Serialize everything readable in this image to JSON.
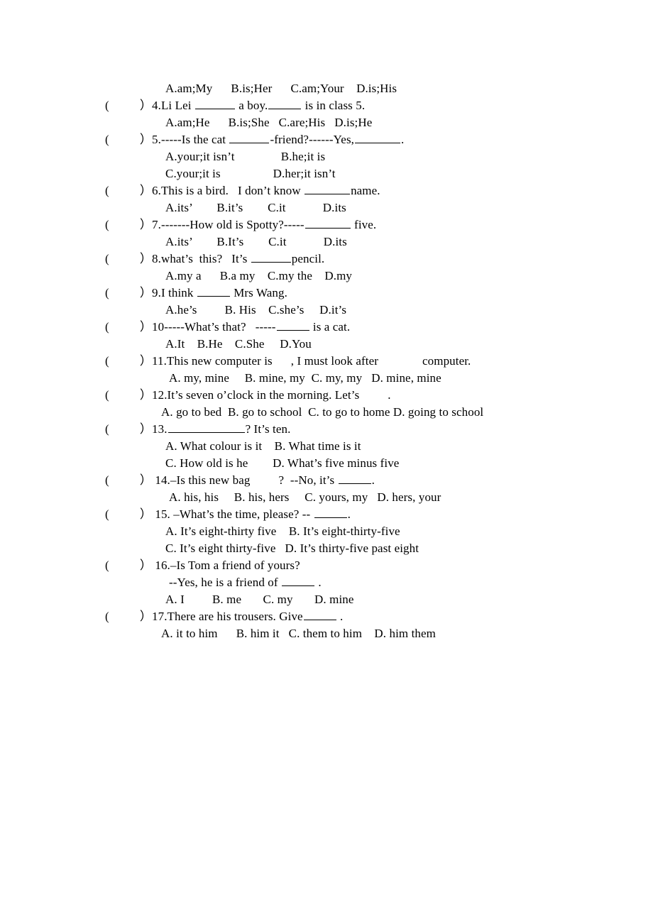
{
  "document": {
    "type": "english-grammar-multiple-choice-worksheet",
    "background_color": "#ffffff",
    "text_color": "#000000"
  },
  "bracket": {
    "open": "(",
    "close": "）"
  },
  "orphan_options_line": "A.am;My      B.is;Her      C.am;Your    D.is;His",
  "questions": [
    {
      "number": "4.",
      "stem_before": "4.Li Lei ",
      "stem_mid": " a boy.",
      "stem_after": " is in class 5.",
      "options": "A.am;He      B.is;She   C.are;His   D.is;He"
    },
    {
      "number": "5.",
      "stem_before": "5.-----Is the cat ",
      "stem_mid": "-friend?------Yes,",
      "stem_after": ".",
      "options_1": "A.your;it isn’t               B.he;it is",
      "options_2": "C.your;it is                 D.her;it isn’t"
    },
    {
      "number": "6.",
      "stem_before": "6.This is a bird.   I don’t know ",
      "stem_after": "name.",
      "options": "A.its’        B.it’s        C.it            D.its"
    },
    {
      "number": "7.",
      "stem_before": "7.-------How old is Spotty?-----",
      "stem_after": " five.",
      "options": "A.its’        B.It’s        C.it            D.its"
    },
    {
      "number": "8.",
      "stem_before": "8.what’s  this?   It’s ",
      "stem_after": "pencil.",
      "options": "A.my a      B.a my    C.my the    D.my"
    },
    {
      "number": "9.",
      "stem_before": "9.I think ",
      "stem_after": " Mrs Wang.",
      "options": "A.he’s         B. His    C.she’s     D.it’s"
    },
    {
      "number": "10",
      "stem_before": "10-----What’s that?   -----",
      "stem_after": " is a cat.",
      "options": "A.It    B.He    C.She     D.You"
    },
    {
      "number": "11.",
      "stem_before": "11.This new computer is",
      "stem_mid": ", I must look after",
      "stem_after": "computer.",
      "options": "A. my, mine     B. mine, my  C. my, my   D. mine, mine"
    },
    {
      "number": "12.",
      "stem_before": "12.It’s seven o’clock in the morning. Let’s",
      "stem_after": ".",
      "options": "A. go to bed  B. go to school  C. to go to home D. going to school"
    },
    {
      "number": "13.",
      "stem_before": "13.",
      "stem_after": "? It’s ten.",
      "options_1": "A. What colour is it    B. What time is it",
      "options_2": "C. How old is he        D. What’s five minus five"
    },
    {
      "number": "14.",
      "stem_before": "14.–Is this new bag",
      "stem_mid": "?  --No, it’s ",
      "stem_after": ".",
      "options": "A. his, his     B. his, hers     C. yours, my   D. hers, your"
    },
    {
      "number": "15.",
      "stem_before": "15. –What’s the time, please? -- ",
      "stem_after": ".",
      "options_1": "A. It’s eight-thirty five    B. It’s eight-thirty-five",
      "options_2": "C. It’s eight thirty-five   D. It’s thirty-five past eight"
    },
    {
      "number": "16.",
      "stem_before": "16.–Is Tom a friend of yours?",
      "continuation_before": "--Yes, he is a friend of ",
      "continuation_after": " .",
      "options": "A. I         B. me       C. my       D. mine"
    },
    {
      "number": "17.",
      "stem_before": "17.There are his trousers. Give",
      "stem_after": " .",
      "options": "A. it to him      B. him it   C. them to him    D. him them"
    }
  ]
}
